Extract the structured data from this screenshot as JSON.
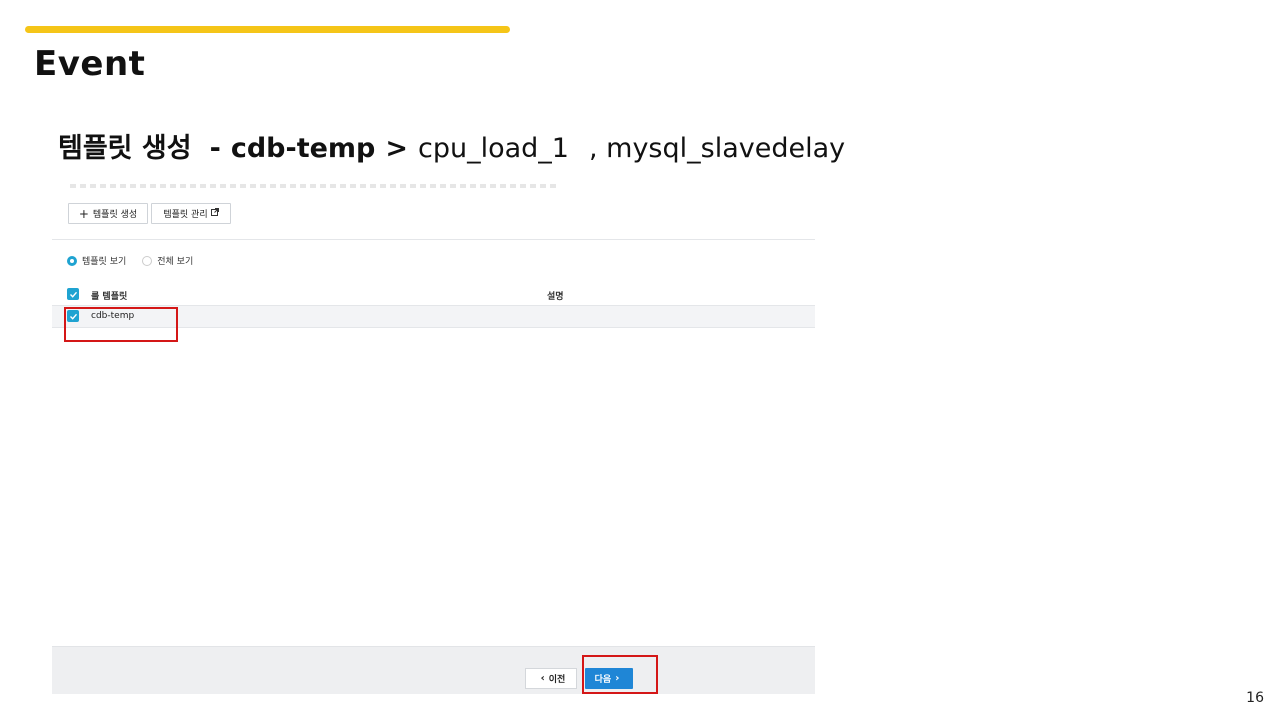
{
  "slide": {
    "title": "Event",
    "subtitle": {
      "part1": "템플릿 생성",
      "dash": "-",
      "part2": "cdb-temp",
      "arrow": ">",
      "part3": "cpu_load_1",
      "comma_item": ", mysql_slavedelay"
    },
    "page_number": "16",
    "accent_color": "#f5c518",
    "highlight_color": "#d41717"
  },
  "toolbar": {
    "create_label": "템플릿 생성",
    "create_icon": "plus-icon",
    "manage_label": "템플릿 관리",
    "manage_icon": "external-link-icon"
  },
  "view_options": {
    "template_view": "템플릿 보기",
    "all_view": "전체 보기",
    "selected": "템플릿 보기"
  },
  "table": {
    "columns": [
      "룰 템플릿",
      "설명"
    ],
    "rows": [
      {
        "name": "cdb-temp",
        "description": "",
        "checked": true
      }
    ]
  },
  "footer": {
    "prev_label": "이전",
    "next_label": "다음",
    "primary_color": "#1f86d6"
  }
}
